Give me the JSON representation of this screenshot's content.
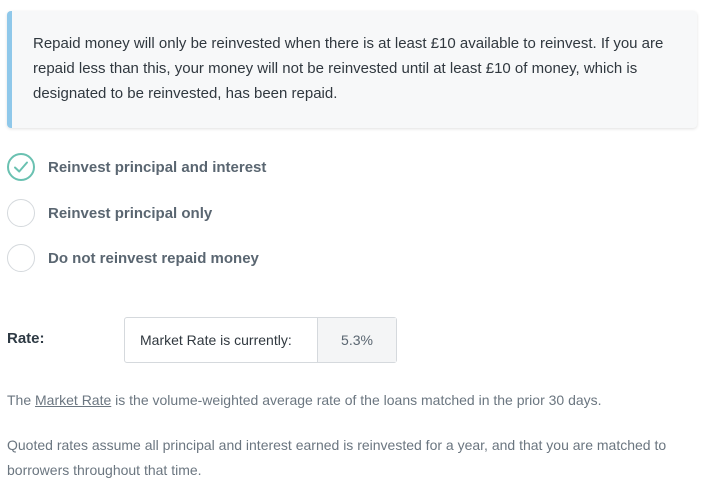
{
  "info_callout": {
    "text": "Repaid money will only be reinvested when there is at least £10 available to reinvest. If you are repaid less than this, your money will not be reinvested until at least £10 of money, which is designated to be reinvested, has been repaid."
  },
  "reinvest_options": [
    {
      "label": "Reinvest principal and interest",
      "checked": true
    },
    {
      "label": "Reinvest principal only",
      "checked": false
    },
    {
      "label": "Do not reinvest repaid money",
      "checked": false
    }
  ],
  "rate": {
    "label": "Rate:",
    "description": "Market Rate is currently:",
    "value": "5.3%"
  },
  "notes": {
    "market_rate_prefix": "The ",
    "market_rate_link": "Market Rate",
    "market_rate_suffix": " is the volume-weighted average rate of the loans matched in the prior 30 days.",
    "quoted_rates": "Quoted rates assume all principal and interest earned is reinvested for a year, and that you are matched to borrowers throughout that time."
  },
  "colors": {
    "callout_border": "#8fc8ea",
    "checked_accent": "#6ac1b1"
  }
}
